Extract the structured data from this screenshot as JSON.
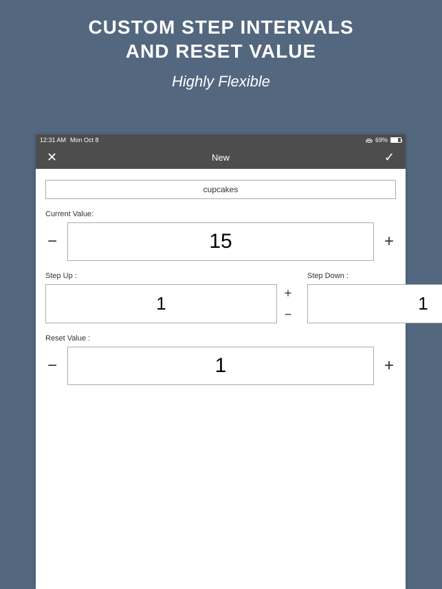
{
  "promo": {
    "title_line1": "CUSTOM STEP INTERVALS",
    "title_line2": "AND RESET VALUE",
    "subtitle": "Highly Flexible"
  },
  "status": {
    "time": "12:31 AM",
    "date": "Mon Oct 8",
    "battery": "69%"
  },
  "nav": {
    "title": "New"
  },
  "form": {
    "name_value": "cupcakes",
    "current_label": "Current Value:",
    "current_value": "15",
    "step_up_label": "Step Up :",
    "step_up_value": "1",
    "step_down_label": "Step Down :",
    "step_down_value": "1",
    "reset_label": "Reset Value :",
    "reset_value": "1"
  },
  "glyphs": {
    "minus": "−",
    "plus": "+",
    "close": "✕",
    "check": "✓"
  }
}
